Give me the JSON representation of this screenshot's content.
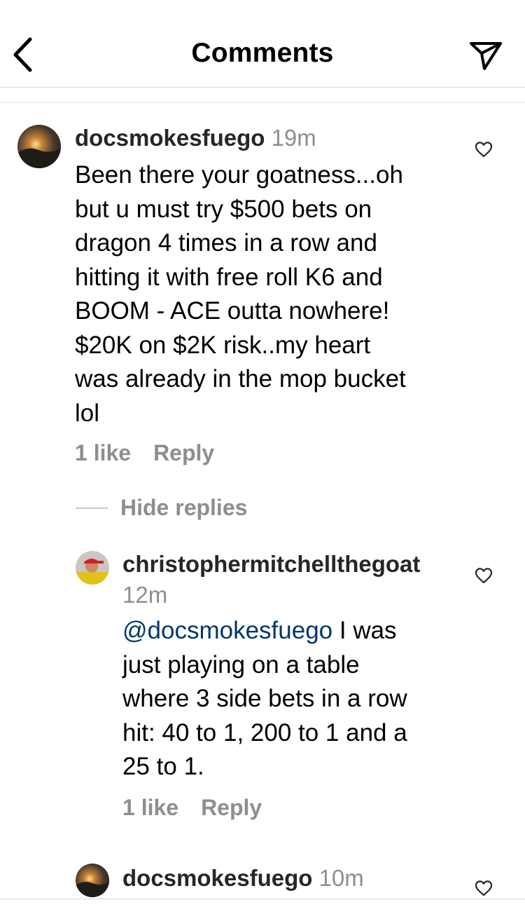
{
  "header": {
    "title": "Comments"
  },
  "comments": [
    {
      "username": "docsmokesfuego",
      "time": "19m",
      "lines": [
        "Been there your goatness...oh",
        "but u must try $500 bets on",
        "dragon  4 times in a row and",
        "hitting it with free roll K6 and",
        "BOOM - ACE outta nowhere!",
        "$20K on $2K risk..my heart",
        "was already in the mop bucket",
        "lol"
      ],
      "likes": "1 like",
      "reply_label": "Reply"
    }
  ],
  "hide_replies_label": "Hide replies",
  "reply": {
    "username": "christophermitchellthegoat",
    "time": "12m",
    "mention": "@docsmokesfuego",
    "first_line_rest": " I was",
    "lines": [
      "just playing on a table",
      "where 3 side bets in a row",
      "hit:  40 to 1, 200 to 1 and a",
      "25 to 1."
    ],
    "likes": "1 like",
    "reply_label": "Reply"
  },
  "partial_comment": {
    "username": "docsmokesfuego",
    "time": "10m"
  },
  "icons": {
    "back": "chevron-left-icon",
    "share": "paper-plane-icon",
    "like": "heart-outline-icon"
  }
}
